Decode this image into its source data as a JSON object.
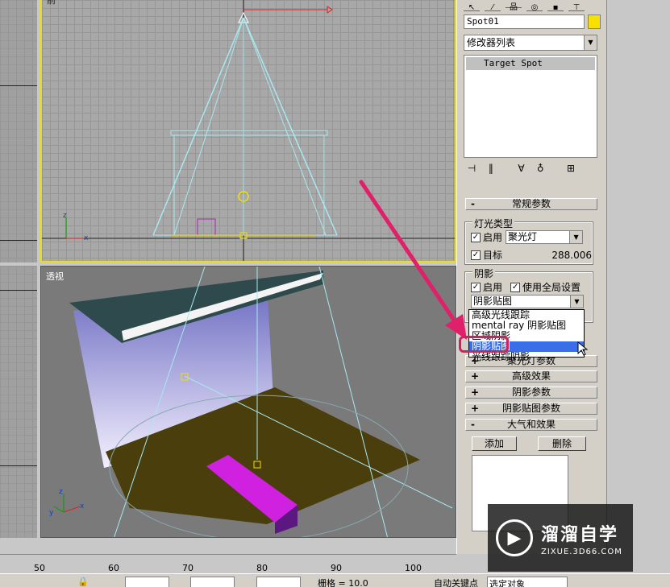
{
  "viewports": {
    "front_label": "前",
    "persp_label": "透视"
  },
  "panel": {
    "object_name": "Spot01",
    "modifier_list": "修改器列表",
    "stack_item": "Target Spot",
    "general_params": "常规参数",
    "light_type_group": "灯光类型",
    "on_label": "启用",
    "light_type_value": "聚光灯",
    "target_label": "目标",
    "target_distance": "288.006",
    "shadows_group": "阴影",
    "shadow_on_label": "启用",
    "use_global_label": "使用全局设置",
    "shadow_type_value": "阴影贴图",
    "popup_items": [
      "高级光线跟踪",
      "mental ray 阴影贴图",
      "区域阴影",
      "阴影贴图",
      "光线跟踪阴影"
    ],
    "rollouts": [
      {
        "sign": "+",
        "label": "聚光灯参数"
      },
      {
        "sign": "+",
        "label": "高级效果"
      },
      {
        "sign": "+",
        "label": "阴影参数"
      },
      {
        "sign": "+",
        "label": "阴影贴图参数"
      },
      {
        "sign": "-",
        "label": "大气和效果"
      }
    ],
    "add_button": "添加",
    "delete_button": "删除"
  },
  "timeline": {
    "ticks": [
      "50",
      "60",
      "70",
      "80",
      "90",
      "100"
    ]
  },
  "statusbar": {
    "grid_label": "栅格 = 10.0",
    "auto_key": "自动关键点",
    "selection_set": "选定对象"
  },
  "watermark": {
    "title": "溜溜自学",
    "url": "ZIXUE.3D66.COM"
  },
  "colors": {
    "accent_yellow": "#f0e000",
    "selection_blue": "#3a6ee8",
    "annotation_pink": "#d02060"
  }
}
